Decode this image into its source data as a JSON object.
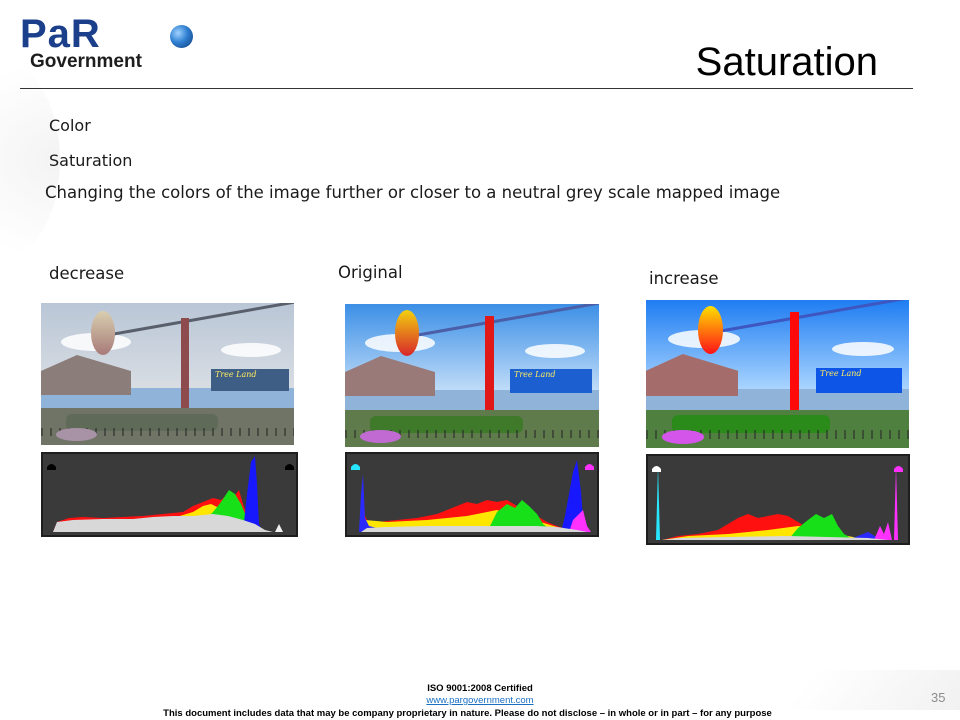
{
  "header": {
    "logo_par": "PaR",
    "logo_government": "Government",
    "title": "Saturation"
  },
  "body": {
    "category": "Color",
    "subcategory": "Saturation",
    "description": "Changing the colors of the image further or closer to a neutral grey scale mapped image"
  },
  "panels": [
    {
      "caption": "decrease",
      "sign_text": "Tree Land",
      "clip_left_color": "#000000",
      "clip_right_color": "#000000"
    },
    {
      "caption": "Original",
      "sign_text": "Tree Land",
      "clip_left_color": "#27e7ff",
      "clip_right_color": "#ff31ff"
    },
    {
      "caption": "increase",
      "sign_text": "Tree Land",
      "clip_left_color": "#ffffff",
      "clip_right_color": "#ff31ff"
    }
  ],
  "footer": {
    "certification": "ISO 9001:2008 Certified",
    "website": "www.pargovernment.com",
    "disclaimer": "This document includes data that may be company proprietary in nature. Please do not disclose – in whole or in part – for any purpose",
    "slide_number": "35"
  }
}
